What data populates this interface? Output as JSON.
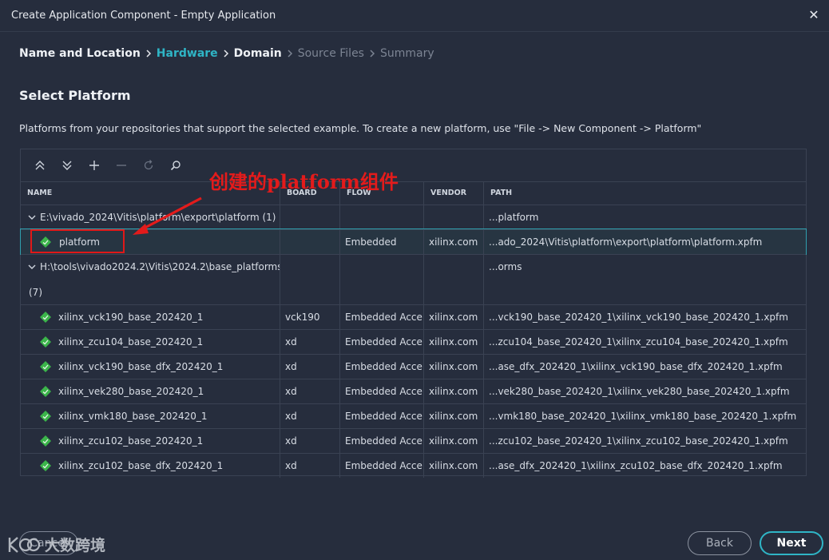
{
  "window": {
    "title": "Create Application Component - Empty Application",
    "close_glyph": "✕"
  },
  "breadcrumb": [
    {
      "label": "Name and Location",
      "state": "done"
    },
    {
      "label": "Hardware",
      "state": "active"
    },
    {
      "label": "Domain",
      "state": "done"
    },
    {
      "label": "Source Files",
      "state": "future"
    },
    {
      "label": "Summary",
      "state": "future"
    }
  ],
  "section": {
    "heading": "Select Platform",
    "description": "Platforms from your repositories that support the selected example. To create a new platform, use \"File -> New Component -> Platform\""
  },
  "toolbar_icons": [
    "collapse-all-icon",
    "expand-all-icon",
    "add-icon",
    "remove-icon",
    "refresh-icon",
    "search-icon"
  ],
  "table": {
    "columns": [
      "NAME",
      "BOARD",
      "FLOW",
      "VENDOR",
      "PATH"
    ],
    "groups": [
      {
        "name": "E:\\vivado_2024\\Vitis\\platform\\export\\platform  (1)",
        "path": "...platform",
        "rows": [
          {
            "name": "platform",
            "board": "",
            "flow": "Embedded",
            "vendor": "xilinx.com",
            "path": "...ado_2024\\Vitis\\platform\\export\\platform\\platform.xpfm",
            "selected": true
          }
        ]
      },
      {
        "name": "H:\\tools\\vivado2024.2\\Vitis\\2024.2\\base_platforms",
        "name_line2": "(7)",
        "path": "...orms",
        "rows": [
          {
            "name": "xilinx_vck190_base_202420_1",
            "board": "vck190",
            "flow": "Embedded Accel",
            "vendor": "xilinx.com",
            "path": "...vck190_base_202420_1\\xilinx_vck190_base_202420_1.xpfm"
          },
          {
            "name": "xilinx_zcu104_base_202420_1",
            "board": "xd",
            "flow": "Embedded Accel",
            "vendor": "xilinx.com",
            "path": "...zcu104_base_202420_1\\xilinx_zcu104_base_202420_1.xpfm"
          },
          {
            "name": "xilinx_vck190_base_dfx_202420_1",
            "board": "xd",
            "flow": "Embedded Accel",
            "vendor": "xilinx.com",
            "path": "...ase_dfx_202420_1\\xilinx_vck190_base_dfx_202420_1.xpfm"
          },
          {
            "name": "xilinx_vek280_base_202420_1",
            "board": "xd",
            "flow": "Embedded Accel",
            "vendor": "xilinx.com",
            "path": "...vek280_base_202420_1\\xilinx_vek280_base_202420_1.xpfm"
          },
          {
            "name": "xilinx_vmk180_base_202420_1",
            "board": "xd",
            "flow": "Embedded Accel",
            "vendor": "xilinx.com",
            "path": "...vmk180_base_202420_1\\xilinx_vmk180_base_202420_1.xpfm"
          },
          {
            "name": "xilinx_zcu102_base_202420_1",
            "board": "xd",
            "flow": "Embedded Accel",
            "vendor": "xilinx.com",
            "path": "...zcu102_base_202420_1\\xilinx_zcu102_base_202420_1.xpfm"
          },
          {
            "name": "xilinx_zcu102_base_dfx_202420_1",
            "board": "xd",
            "flow": "Embedded Accel",
            "vendor": "xilinx.com",
            "path": "...ase_dfx_202420_1\\xilinx_zcu102_base_dfx_202420_1.xpfm"
          }
        ]
      }
    ]
  },
  "annotation": {
    "text": "创建的platform组件",
    "color": "#e31b1b"
  },
  "buttons": {
    "cancel": "Cancel",
    "back": "Back",
    "next": "Next"
  },
  "watermark": {
    "text": "大数跨境"
  },
  "colors": {
    "accent": "#2fb5c6",
    "background": "#262d3d",
    "platform_icon": "#3bb54a"
  }
}
